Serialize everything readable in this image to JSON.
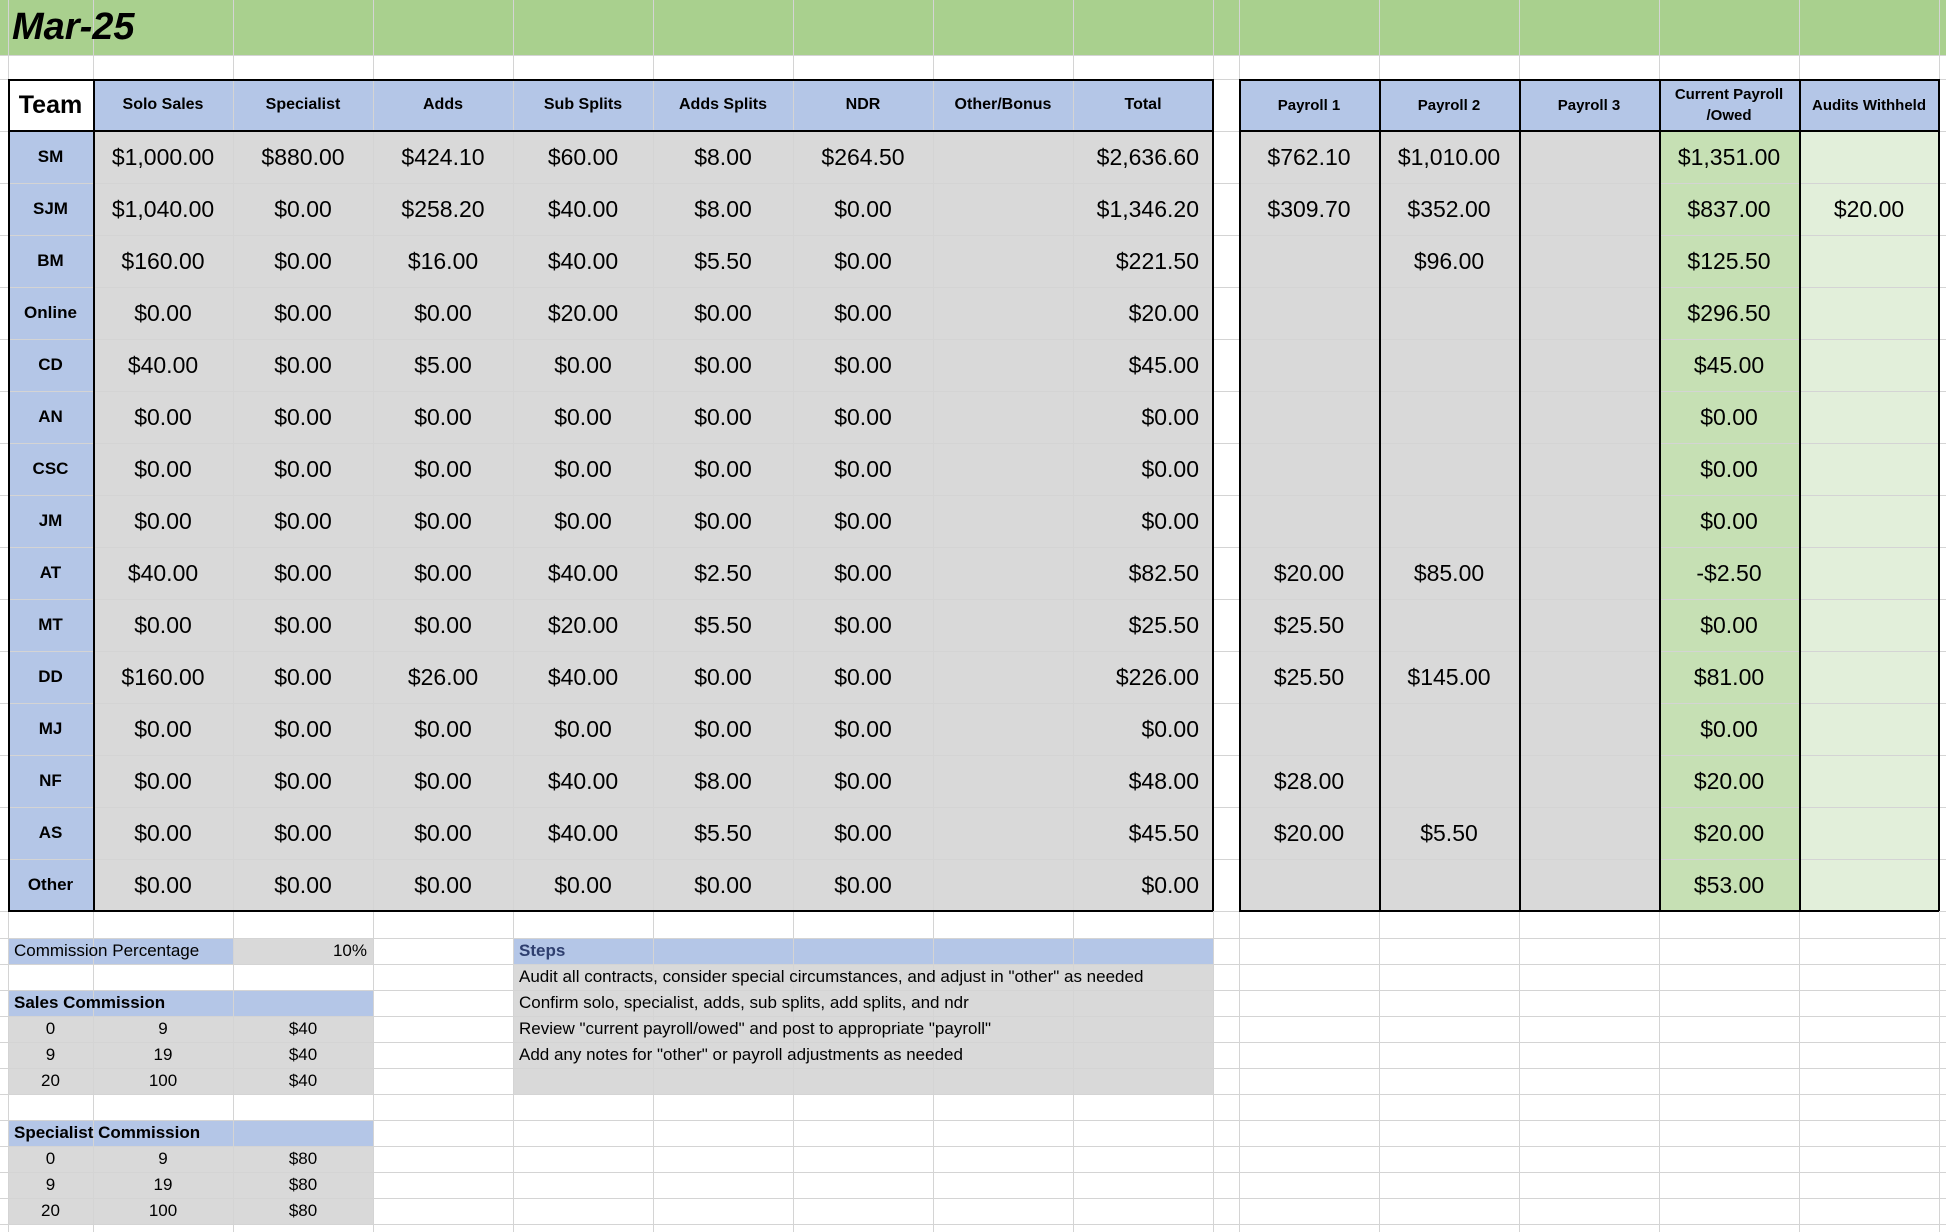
{
  "title": "Mar-25",
  "team_header": "Team",
  "columns": [
    "Solo Sales",
    "Specialist",
    "Adds",
    "Sub Splits",
    "Adds Splits",
    "NDR",
    "Other/Bonus",
    "Total"
  ],
  "payroll_columns": [
    "Payroll 1",
    "Payroll 2",
    "Payroll 3",
    "Current Payroll /Owed",
    "Audits Withheld"
  ],
  "rows": [
    {
      "team": "SM",
      "values": [
        "$1,000.00",
        "$880.00",
        "$424.10",
        "$60.00",
        "$8.00",
        "$264.50",
        "",
        "$2,636.60"
      ],
      "payroll": [
        "$762.10",
        "$1,010.00",
        "",
        "$1,351.00",
        ""
      ]
    },
    {
      "team": "SJM",
      "values": [
        "$1,040.00",
        "$0.00",
        "$258.20",
        "$40.00",
        "$8.00",
        "$0.00",
        "",
        "$1,346.20"
      ],
      "payroll": [
        "$309.70",
        "$352.00",
        "",
        "$837.00",
        "$20.00"
      ]
    },
    {
      "team": "BM",
      "values": [
        "$160.00",
        "$0.00",
        "$16.00",
        "$40.00",
        "$5.50",
        "$0.00",
        "",
        "$221.50"
      ],
      "payroll": [
        "",
        "$96.00",
        "",
        "$125.50",
        ""
      ]
    },
    {
      "team": "Online",
      "values": [
        "$0.00",
        "$0.00",
        "$0.00",
        "$20.00",
        "$0.00",
        "$0.00",
        "",
        "$20.00"
      ],
      "payroll": [
        "",
        "",
        "",
        "$296.50",
        ""
      ]
    },
    {
      "team": "CD",
      "values": [
        "$40.00",
        "$0.00",
        "$5.00",
        "$0.00",
        "$0.00",
        "$0.00",
        "",
        "$45.00"
      ],
      "payroll": [
        "",
        "",
        "",
        "$45.00",
        ""
      ]
    },
    {
      "team": "AN",
      "values": [
        "$0.00",
        "$0.00",
        "$0.00",
        "$0.00",
        "$0.00",
        "$0.00",
        "",
        "$0.00"
      ],
      "payroll": [
        "",
        "",
        "",
        "$0.00",
        ""
      ]
    },
    {
      "team": "CSC",
      "values": [
        "$0.00",
        "$0.00",
        "$0.00",
        "$0.00",
        "$0.00",
        "$0.00",
        "",
        "$0.00"
      ],
      "payroll": [
        "",
        "",
        "",
        "$0.00",
        ""
      ]
    },
    {
      "team": "JM",
      "values": [
        "$0.00",
        "$0.00",
        "$0.00",
        "$0.00",
        "$0.00",
        "$0.00",
        "",
        "$0.00"
      ],
      "payroll": [
        "",
        "",
        "",
        "$0.00",
        ""
      ]
    },
    {
      "team": "AT",
      "values": [
        "$40.00",
        "$0.00",
        "$0.00",
        "$40.00",
        "$2.50",
        "$0.00",
        "",
        "$82.50"
      ],
      "payroll": [
        "$20.00",
        "$85.00",
        "",
        "-$2.50",
        ""
      ]
    },
    {
      "team": "MT",
      "values": [
        "$0.00",
        "$0.00",
        "$0.00",
        "$20.00",
        "$5.50",
        "$0.00",
        "",
        "$25.50"
      ],
      "payroll": [
        "$25.50",
        "",
        "",
        "$0.00",
        ""
      ]
    },
    {
      "team": "DD",
      "values": [
        "$160.00",
        "$0.00",
        "$26.00",
        "$40.00",
        "$0.00",
        "$0.00",
        "",
        "$226.00"
      ],
      "payroll": [
        "$25.50",
        "$145.00",
        "",
        "$81.00",
        ""
      ]
    },
    {
      "team": "MJ",
      "values": [
        "$0.00",
        "$0.00",
        "$0.00",
        "$0.00",
        "$0.00",
        "$0.00",
        "",
        "$0.00"
      ],
      "payroll": [
        "",
        "",
        "",
        "$0.00",
        ""
      ]
    },
    {
      "team": "NF",
      "values": [
        "$0.00",
        "$0.00",
        "$0.00",
        "$40.00",
        "$8.00",
        "$0.00",
        "",
        "$48.00"
      ],
      "payroll": [
        "$28.00",
        "",
        "",
        "$20.00",
        ""
      ]
    },
    {
      "team": "AS",
      "values": [
        "$0.00",
        "$0.00",
        "$0.00",
        "$40.00",
        "$5.50",
        "$0.00",
        "",
        "$45.50"
      ],
      "payroll": [
        "$20.00",
        "$5.50",
        "",
        "$20.00",
        ""
      ]
    },
    {
      "team": "Other",
      "values": [
        "$0.00",
        "$0.00",
        "$0.00",
        "$0.00",
        "$0.00",
        "$0.00",
        "",
        "$0.00"
      ],
      "payroll": [
        "",
        "",
        "",
        "$53.00",
        ""
      ]
    }
  ],
  "commission": {
    "label": "Commission Percentage",
    "value": "10%"
  },
  "sales_commission": {
    "title": "Sales Commission",
    "rows": [
      [
        "0",
        "9",
        "$40"
      ],
      [
        "9",
        "19",
        "$40"
      ],
      [
        "20",
        "100",
        "$40"
      ]
    ]
  },
  "specialist_commission": {
    "title": "Specialist Commission",
    "rows": [
      [
        "0",
        "9",
        "$80"
      ],
      [
        "9",
        "19",
        "$80"
      ],
      [
        "20",
        "100",
        "$80"
      ]
    ]
  },
  "steps": {
    "title": "Steps",
    "items": [
      "Audit all contracts, consider special circumstances, and adjust in \"other\" as needed",
      "Confirm solo, specialist, adds, sub splits, add splits, and ndr",
      "Review \"current payroll/owed\" and post to appropriate \"payroll\"",
      "Add any notes for \"other\" or payroll adjustments as needed"
    ]
  },
  "colors": {
    "title_bar": "#a9d08e",
    "header_blue": "#b4c6e7",
    "data_gray": "#d9d9d9",
    "owed_green": "#c6e0b4",
    "audit_green": "#e2efda"
  }
}
